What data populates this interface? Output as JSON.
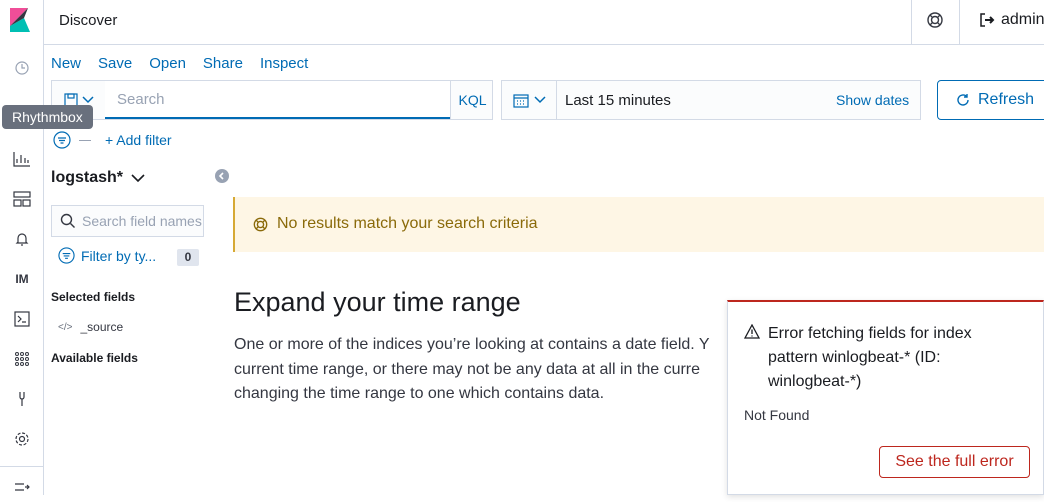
{
  "tooltip": "Rhythmbox",
  "header": {
    "title": "Discover",
    "user": "admin"
  },
  "menu": {
    "new": "New",
    "save": "Save",
    "open": "Open",
    "share": "Share",
    "inspect": "Inspect"
  },
  "query": {
    "placeholder": "Search",
    "language": "KQL"
  },
  "date": {
    "range": "Last 15 minutes",
    "show_dates": "Show dates"
  },
  "refresh_label": "Refresh",
  "filter": {
    "add_label": "+ Add filter"
  },
  "sidebar": {
    "index_pattern": "logstash*",
    "field_search_placeholder": "Search field names",
    "filter_by_type": "Filter by ty...",
    "type_count": "0",
    "selected_fields_label": "Selected fields",
    "selected_fields": [
      "_source"
    ],
    "available_fields_label": "Available fields"
  },
  "main": {
    "callout": "No results match your search criteria",
    "expand_title": "Expand your time range",
    "expand_body": "One or more of the indices you’re looking at contains a date field. Y\ncurrent time range, or there may not be any data at all in the curre\nchanging the time range to one which contains data."
  },
  "toast": {
    "title": "Error fetching fields for index pattern winlogbeat-* (ID: winlogbeat-*)",
    "body": "Not Found",
    "button": "See the full error"
  },
  "colors": {
    "accent": "#006bb4",
    "danger": "#bd271e",
    "warning_bg": "#fef6e5"
  }
}
